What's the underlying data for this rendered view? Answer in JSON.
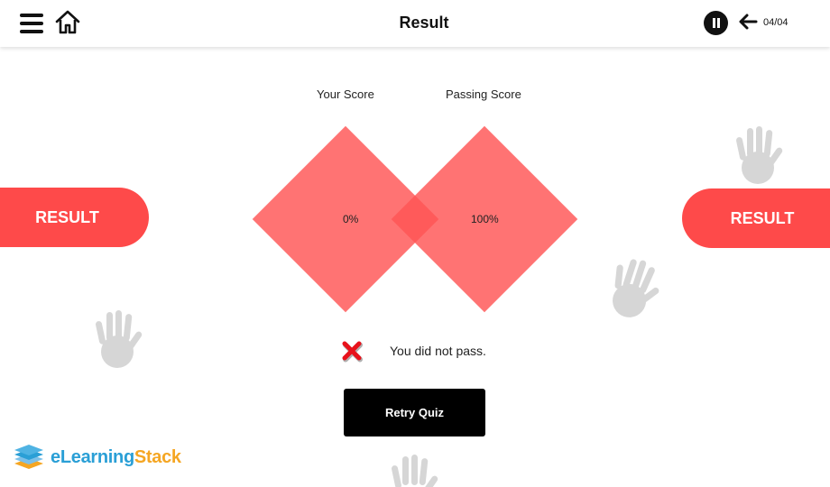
{
  "header": {
    "title": "Result",
    "page_counter": "04/04",
    "icons": [
      "menu-icon",
      "home-icon",
      "pause-icon",
      "back-arrow-icon"
    ]
  },
  "banners": {
    "left_label": "RESULT",
    "right_label": "RESULT",
    "color": "#fe4a4a"
  },
  "scores": {
    "your_score_label": "Your Score",
    "your_score_value": "0%",
    "passing_score_label": "Passing Score",
    "passing_score_value": "100%",
    "diamond_color": "#ff5454"
  },
  "feedback": {
    "message": "You did not pass.",
    "icon": "fail-x-icon",
    "icon_color": "#e8121b"
  },
  "actions": {
    "retry_label": "Retry Quiz"
  },
  "branding": {
    "logo_part1": "eLearning",
    "logo_part2": "Stack",
    "colors": {
      "primary": "#2a9fd6",
      "secondary": "#f5a623"
    }
  },
  "decorations": {
    "icon": "hand-icon",
    "color": "#d6d6d6"
  }
}
